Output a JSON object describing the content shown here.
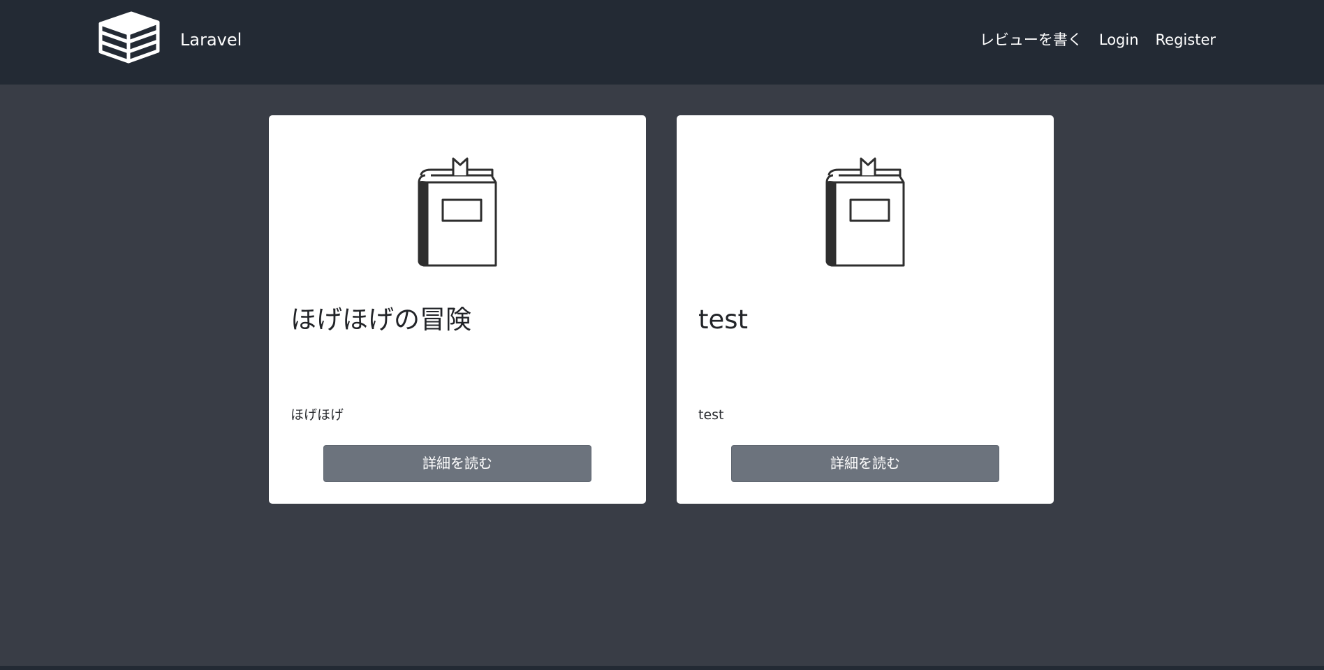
{
  "header": {
    "brand_name": "Laravel",
    "nav": [
      {
        "label": "レビューを書く"
      },
      {
        "label": "Login"
      },
      {
        "label": "Register"
      }
    ]
  },
  "books": [
    {
      "title": "ほげほげの冒険",
      "description": "ほげほげ",
      "button_label": "詳細を読む",
      "icon": "book-icon"
    },
    {
      "title": "test",
      "description": "test",
      "button_label": "詳細を読む",
      "icon": "book-icon"
    }
  ],
  "colors": {
    "navbar": "#232a34",
    "background": "#393d46",
    "card": "#ffffff",
    "button": "#6c737d"
  }
}
